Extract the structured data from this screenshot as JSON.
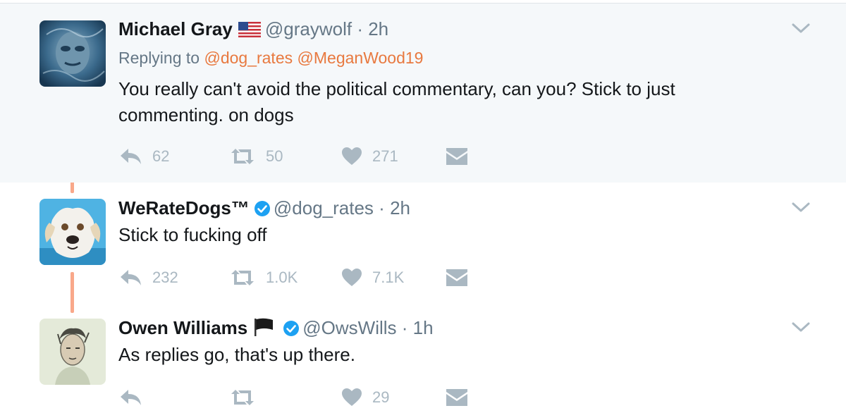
{
  "tweets": [
    {
      "name": "Michael Gray",
      "handle": "@graywolf",
      "separator": "·",
      "time": "2h",
      "flag": "us-flag-emoji",
      "replying_label": "Replying to",
      "replying_to": [
        "@dog_rates",
        "@MeganWood19"
      ],
      "text": "You really can't avoid the political commentary, can you? Stick to just commenting. on dogs",
      "replies": "62",
      "retweets": "50",
      "likes": "271",
      "highlighted": true
    },
    {
      "name": "WeRateDogs™",
      "handle": "@dog_rates",
      "separator": "·",
      "time": "2h",
      "verified": true,
      "text": "Stick to fucking off",
      "replies": "232",
      "retweets": "1.0K",
      "likes": "7.1K"
    },
    {
      "name": "Owen Williams",
      "handle": "@OwsWills",
      "separator": "·",
      "time": "1h",
      "flag": "black-flag-emoji",
      "verified": true,
      "text": "As replies go, that's up there.",
      "replies": "",
      "retweets": "",
      "likes": "29"
    }
  ],
  "colors": {
    "highlight_bg": "#f5f8fa",
    "thread_line": "#f9a88a",
    "mention": "#e8793f",
    "muted_text": "#657786",
    "action_icon": "#aab8c2",
    "verified": "#1da1f2"
  },
  "icons": [
    "reply-icon",
    "retweet-icon",
    "like-icon",
    "direct-message-icon",
    "chevron-down-icon",
    "verified-badge-icon"
  ]
}
